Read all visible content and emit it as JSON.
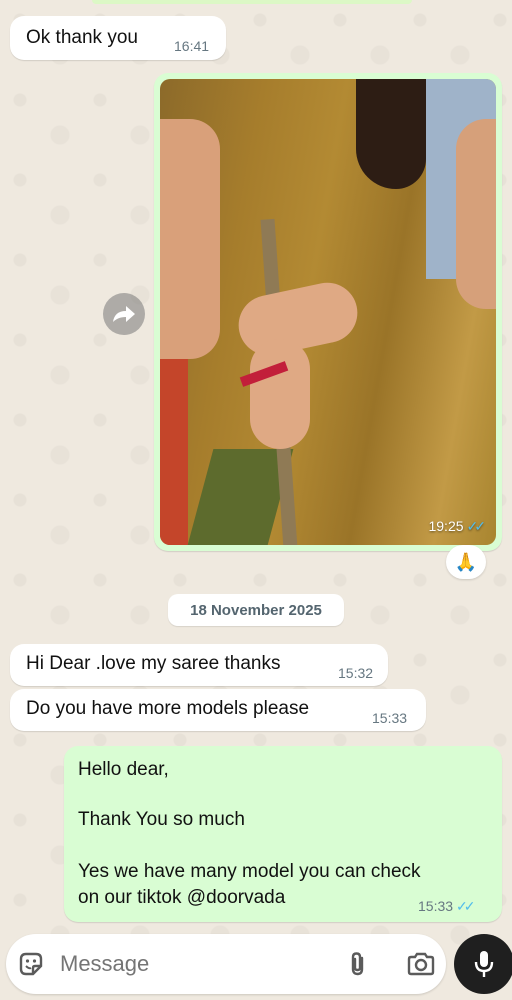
{
  "messages": {
    "ok_thanks": {
      "text": "Ok thank you",
      "time": "16:41"
    },
    "photo": {
      "time": "19:25",
      "reaction": "🙏"
    },
    "date_chip": "18 November 2025",
    "hi_dear": {
      "text": "Hi Dear .love my saree thanks",
      "time": "15:32"
    },
    "more_models": {
      "text": "Do you have more models please",
      "time": "15:33"
    },
    "reply": {
      "line1": "Hello dear,",
      "line2": "Thank You so much",
      "line3": "Yes we have many model you can check",
      "line4": "on our tiktok @doorvada",
      "time": "15:33"
    }
  },
  "composer": {
    "placeholder": "Message",
    "icons": [
      "sticker-icon",
      "paperclip-icon",
      "camera-icon",
      "microphone-icon"
    ]
  },
  "colors": {
    "outgoing_bubble": "#d9fdd3",
    "incoming_bubble": "#ffffff",
    "read_ticks": "#53bdeb",
    "background": "#efe9df"
  }
}
